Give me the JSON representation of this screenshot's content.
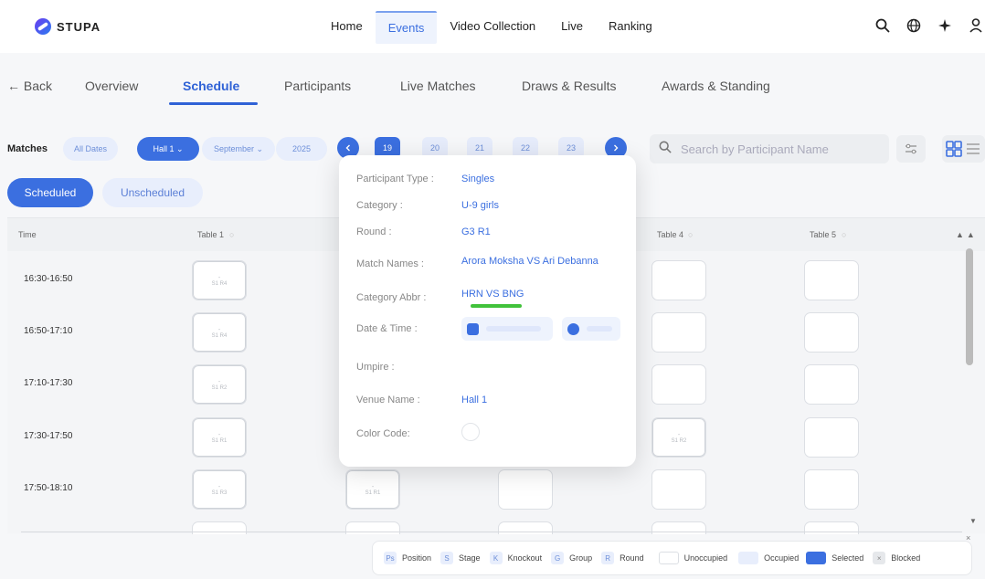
{
  "brand": {
    "name": "STUPA"
  },
  "nav": {
    "items": [
      "Home",
      "Events",
      "Video Collection",
      "Live",
      "Ranking"
    ],
    "active": "Events"
  },
  "top_icons": [
    "search-icon",
    "globe-icon",
    "sparkle-icon",
    "user-icon"
  ],
  "subnav": {
    "back": "← Back",
    "items": [
      "Overview",
      "Schedule",
      "Participants",
      "Live Matches",
      "Draws & Results",
      "Awards & Standing"
    ],
    "active": "Schedule"
  },
  "filters": {
    "label": "Matches",
    "all_dates": "All Dates",
    "hall": "Hall 1  ⌄",
    "month": "September ⌄",
    "year": "2025",
    "dates": [
      "19",
      "20",
      "21",
      "22",
      "23"
    ],
    "active_date": "19",
    "search_placeholder": "Search by Participant Name"
  },
  "toggles": {
    "scheduled": "Scheduled",
    "unscheduled": "Unscheduled"
  },
  "grid": {
    "headers": {
      "time": "Time",
      "table1": "Table 1",
      "table4": "Table 4",
      "table5": "Table 5"
    },
    "times": [
      "16:30-16:50",
      "16:50-17:10",
      "17:10-17:30",
      "17:30-17:50",
      "17:50-18:10"
    ],
    "table1_cells": [
      "S1 R4",
      "S1 R4",
      "S1 R2",
      "S1 R1",
      "S1 R3"
    ],
    "table2_cell": "S1 R1",
    "table4_cell": "S1 R2"
  },
  "legend": {
    "position_key": "Ps",
    "position": "Position",
    "stage_key": "S",
    "stage": "Stage",
    "knockout_key": "K",
    "knockout": "Knockout",
    "group_key": "G",
    "group": "Group",
    "round_key": "R",
    "round": "Round",
    "unoccupied": "Unoccupied",
    "occupied": "Occupied",
    "selected": "Selected",
    "blocked": "Blocked",
    "close": "×",
    "colors": {
      "unoccupied": "#ffffff",
      "occupied": "#e8eefc",
      "selected": "#3b6fe0",
      "blocked": "#e6e8eb"
    }
  },
  "popup": {
    "participant_type_label": "Participant Type :",
    "participant_type": "Singles",
    "category_label": "Category :",
    "category": "U-9 girls",
    "round_label": "Round :",
    "round": "G3 R1",
    "match_names_label": "Match Names :",
    "match_names": "Arora Moksha VS Ari Debanna",
    "category_abbr_label": "Category Abbr :",
    "category_abbr": "HRN VS BNG",
    "date_time_label": "Date & Time :",
    "umpire_label": "Umpire :",
    "venue_label": "Venue Name :",
    "venue": "Hall 1",
    "color_code_label": "Color Code:"
  },
  "colors": {
    "accent": "#3b6fe0",
    "highlight": "#41c23b"
  }
}
